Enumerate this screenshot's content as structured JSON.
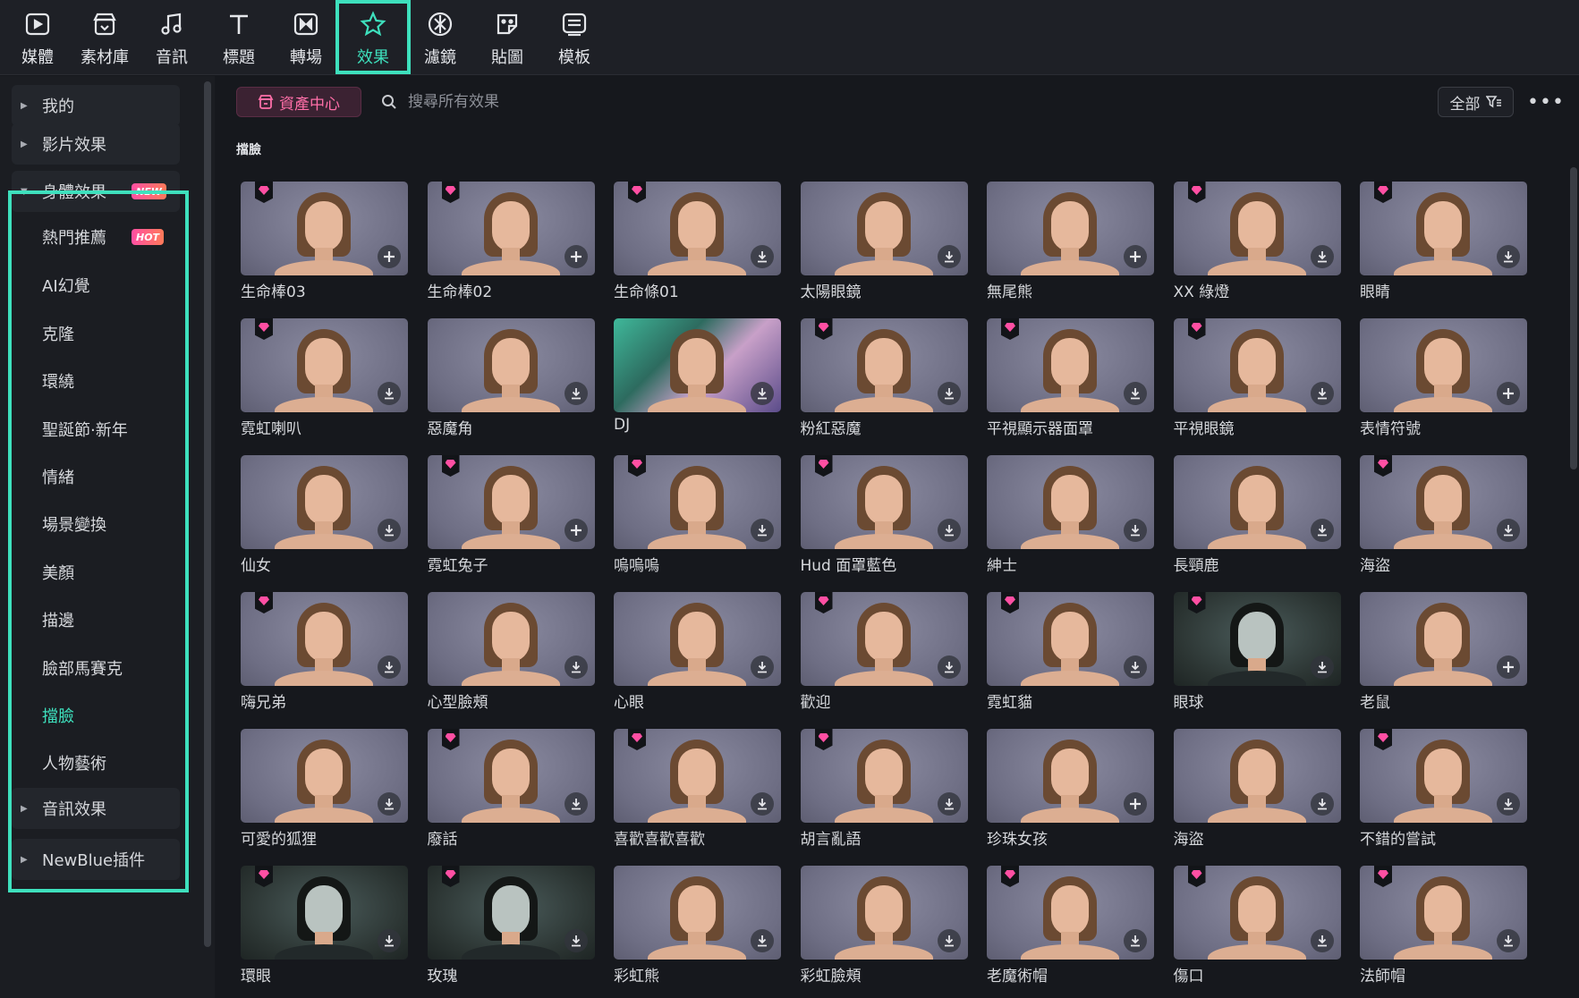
{
  "toolbar": {
    "tabs": [
      {
        "label": "媒體",
        "icon": "media-icon",
        "active": false
      },
      {
        "label": "素材庫",
        "icon": "library-icon",
        "active": false
      },
      {
        "label": "音訊",
        "icon": "music-note-icon",
        "active": false
      },
      {
        "label": "標題",
        "icon": "title-text-icon",
        "active": false
      },
      {
        "label": "轉場",
        "icon": "transition-icon",
        "active": false
      },
      {
        "label": "效果",
        "icon": "effects-star-icon",
        "active": true
      },
      {
        "label": "濾鏡",
        "icon": "filter-icon",
        "active": false
      },
      {
        "label": "貼圖",
        "icon": "sticker-icon",
        "active": false
      },
      {
        "label": "模板",
        "icon": "template-icon",
        "active": false
      }
    ],
    "accent_color": "#3ee0bd"
  },
  "sidebar": {
    "top_items": [
      {
        "label": "我的"
      },
      {
        "label": "影片效果"
      },
      {
        "label": "身體效果",
        "badge": "NEW",
        "expanded": true
      }
    ],
    "sub_items": [
      {
        "label": "熱門推薦",
        "badge": "HOT"
      },
      {
        "label": "AI幻覺"
      },
      {
        "label": "克隆"
      },
      {
        "label": "環繞"
      },
      {
        "label": "聖誕節·新年"
      },
      {
        "label": "情緒"
      },
      {
        "label": "場景變換"
      },
      {
        "label": "美顏"
      },
      {
        "label": "描邊"
      },
      {
        "label": "臉部馬賽克"
      },
      {
        "label": "擋臉",
        "selected": true
      },
      {
        "label": "人物藝術"
      }
    ],
    "bottom_items": [
      {
        "label": "音訊效果"
      },
      {
        "label": "NewBlue插件"
      }
    ]
  },
  "main": {
    "asset_center_label": "資產中心",
    "search_placeholder": "搜尋所有效果",
    "filter_label": "全部",
    "section_title": "擋臉",
    "items": [
      {
        "name": "生命棒03",
        "premium": true,
        "action": "add"
      },
      {
        "name": "生命棒02",
        "premium": true,
        "action": "add"
      },
      {
        "name": "生命條01",
        "premium": true,
        "action": "download"
      },
      {
        "name": "太陽眼鏡",
        "premium": false,
        "action": "download"
      },
      {
        "name": "無尾熊",
        "premium": false,
        "action": "add"
      },
      {
        "name": "XX 綠燈",
        "premium": true,
        "action": "download"
      },
      {
        "name": "眼睛",
        "premium": true,
        "action": "download"
      },
      {
        "name": "霓虹喇叭",
        "premium": true,
        "action": "download"
      },
      {
        "name": "惡魔角",
        "premium": false,
        "action": "download"
      },
      {
        "name": "DJ",
        "premium": false,
        "action": "download",
        "style": "dj"
      },
      {
        "name": "粉紅惡魔",
        "premium": true,
        "action": "download"
      },
      {
        "name": "平視顯示器面罩",
        "premium": true,
        "action": "download"
      },
      {
        "name": "平視眼鏡",
        "premium": true,
        "action": "download"
      },
      {
        "name": "表情符號",
        "premium": false,
        "action": "add"
      },
      {
        "name": "仙女",
        "premium": false,
        "action": "download"
      },
      {
        "name": "霓虹兔子",
        "premium": true,
        "action": "add"
      },
      {
        "name": "嗚嗚嗚",
        "premium": true,
        "action": "download"
      },
      {
        "name": "Hud 面罩藍色",
        "premium": true,
        "action": "download"
      },
      {
        "name": "紳士",
        "premium": false,
        "action": "download"
      },
      {
        "name": "長頸鹿",
        "premium": false,
        "action": "download"
      },
      {
        "name": "海盜",
        "premium": true,
        "action": "download"
      },
      {
        "name": "嗨兄弟",
        "premium": true,
        "action": "download"
      },
      {
        "name": "心型臉頰",
        "premium": false,
        "action": "download"
      },
      {
        "name": "心眼",
        "premium": false,
        "action": "download"
      },
      {
        "name": "歡迎",
        "premium": true,
        "action": "download"
      },
      {
        "name": "霓虹貓",
        "premium": true,
        "action": "download"
      },
      {
        "name": "眼球",
        "premium": true,
        "action": "download",
        "style": "dark"
      },
      {
        "name": "老鼠",
        "premium": false,
        "action": "add"
      },
      {
        "name": "可愛的狐狸",
        "premium": false,
        "action": "download"
      },
      {
        "name": "廢話",
        "premium": true,
        "action": "download"
      },
      {
        "name": "喜歡喜歡喜歡",
        "premium": true,
        "action": "download"
      },
      {
        "name": "胡言亂語",
        "premium": true,
        "action": "download"
      },
      {
        "name": "珍珠女孩",
        "premium": false,
        "action": "add"
      },
      {
        "name": "海盜",
        "premium": false,
        "action": "download"
      },
      {
        "name": "不錯的嘗試",
        "premium": true,
        "action": "download"
      },
      {
        "name": "環眼",
        "premium": true,
        "action": "download",
        "style": "dark"
      },
      {
        "name": "玫瑰",
        "premium": true,
        "action": "download",
        "style": "dark"
      },
      {
        "name": "彩虹熊",
        "premium": false,
        "action": "download"
      },
      {
        "name": "彩虹臉頰",
        "premium": false,
        "action": "download"
      },
      {
        "name": "老魔術帽",
        "premium": true,
        "action": "download"
      },
      {
        "name": "傷口",
        "premium": true,
        "action": "download"
      },
      {
        "name": "法師帽",
        "premium": true,
        "action": "download"
      }
    ]
  }
}
